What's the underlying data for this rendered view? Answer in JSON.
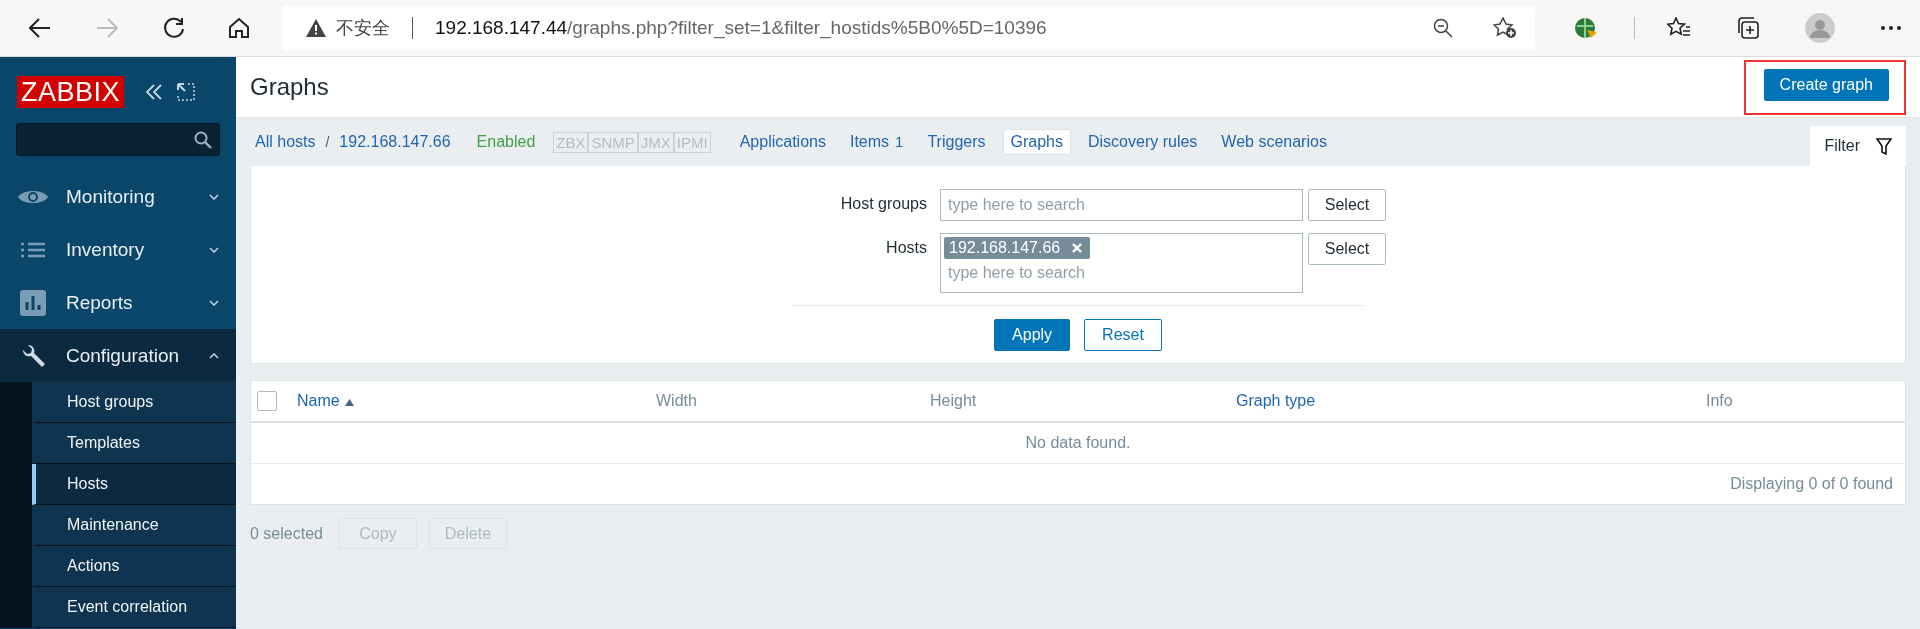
{
  "browser": {
    "security_label": "不安全",
    "url_host": "192.168.147.44",
    "url_path": "/graphs.php?filter_set=1&filter_hostids%5B0%5D=10396"
  },
  "sidebar": {
    "logo": "ZABBIX",
    "menu": [
      {
        "label": "Monitoring",
        "expanded": false
      },
      {
        "label": "Inventory",
        "expanded": false
      },
      {
        "label": "Reports",
        "expanded": false
      },
      {
        "label": "Configuration",
        "expanded": true,
        "children": [
          {
            "label": "Host groups",
            "selected": false
          },
          {
            "label": "Templates",
            "selected": false
          },
          {
            "label": "Hosts",
            "selected": true
          },
          {
            "label": "Maintenance",
            "selected": false
          },
          {
            "label": "Actions",
            "selected": false
          },
          {
            "label": "Event correlation",
            "selected": false
          }
        ]
      }
    ]
  },
  "header": {
    "title": "Graphs",
    "create_button": {
      "label": "Create graph",
      "highlighted": true
    }
  },
  "host_nav": {
    "breadcrumbs": [
      "All hosts",
      "192.168.147.66"
    ],
    "breadcrumb_separator": "/",
    "status": "Enabled",
    "interfaces": [
      {
        "label": "ZBX",
        "available": false
      },
      {
        "label": "SNMP",
        "available": false
      },
      {
        "label": "JMX",
        "available": false
      },
      {
        "label": "IPMI",
        "available": false
      }
    ],
    "tabs": [
      {
        "label": "Applications",
        "selected": false
      },
      {
        "label": "Items",
        "count": "1",
        "selected": false
      },
      {
        "label": "Triggers",
        "selected": false
      },
      {
        "label": "Graphs",
        "selected": true
      },
      {
        "label": "Discovery rules",
        "selected": false
      },
      {
        "label": "Web scenarios",
        "selected": false
      }
    ],
    "filter_tab": {
      "label": "Filter",
      "selected": true
    }
  },
  "filter": {
    "host_groups": {
      "label": "Host groups",
      "placeholder": "type here to search",
      "button": "Select"
    },
    "hosts": {
      "label": "Hosts",
      "chips": [
        "192.168.147.66"
      ],
      "placeholder": "type here to search",
      "button": "Select"
    },
    "apply": "Apply",
    "reset": "Reset"
  },
  "table": {
    "select_all": {
      "checked": false
    },
    "columns": [
      {
        "label": "Name",
        "sortable": true,
        "sorted": true
      },
      {
        "label": "Width",
        "sortable": false,
        "sorted": false
      },
      {
        "label": "Height",
        "sortable": false,
        "sorted": false
      },
      {
        "label": "Graph type",
        "sortable": true,
        "sorted": false
      },
      {
        "label": "Info",
        "sortable": false,
        "sorted": false
      }
    ],
    "empty_message": "No data found.",
    "footer": "Displaying 0 of 0 found"
  },
  "actions": {
    "selected_count": "0 selected",
    "buttons": [
      {
        "label": "Copy",
        "disabled": true
      },
      {
        "label": "Delete",
        "disabled": true
      }
    ]
  }
}
